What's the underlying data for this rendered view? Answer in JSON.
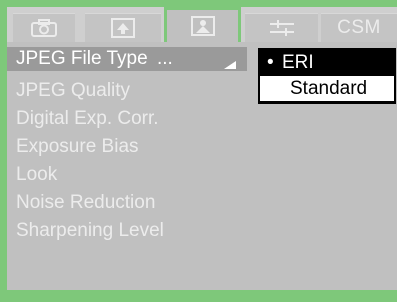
{
  "tabs": [
    {
      "icon": "camera-icon",
      "label": ""
    },
    {
      "icon": "playback-icon",
      "label": ""
    },
    {
      "icon": "image-settings-icon",
      "label": ""
    },
    {
      "icon": "setup-wrench-icon",
      "label": ""
    },
    {
      "icon": "",
      "label": "CSM"
    }
  ],
  "active_tab_index": 2,
  "menu": {
    "items": [
      {
        "label": "JPEG File Type",
        "selected": true
      },
      {
        "label": "JPEG Quality"
      },
      {
        "label": "Digital Exp. Corr."
      },
      {
        "label": "Exposure Bias"
      },
      {
        "label": "Look"
      },
      {
        "label": "Noise Reduction"
      },
      {
        "label": "Sharpening Level"
      }
    ]
  },
  "popup": {
    "bullet": "•",
    "options": [
      {
        "label": "ERI",
        "selected": true
      },
      {
        "label": "Standard",
        "selected": false
      }
    ]
  },
  "colors": {
    "frame_green": "#7ec87a",
    "panel_gray": "#c0c0c0",
    "highlight_gray": "#9a9a9a",
    "text_light": "#ececec"
  }
}
